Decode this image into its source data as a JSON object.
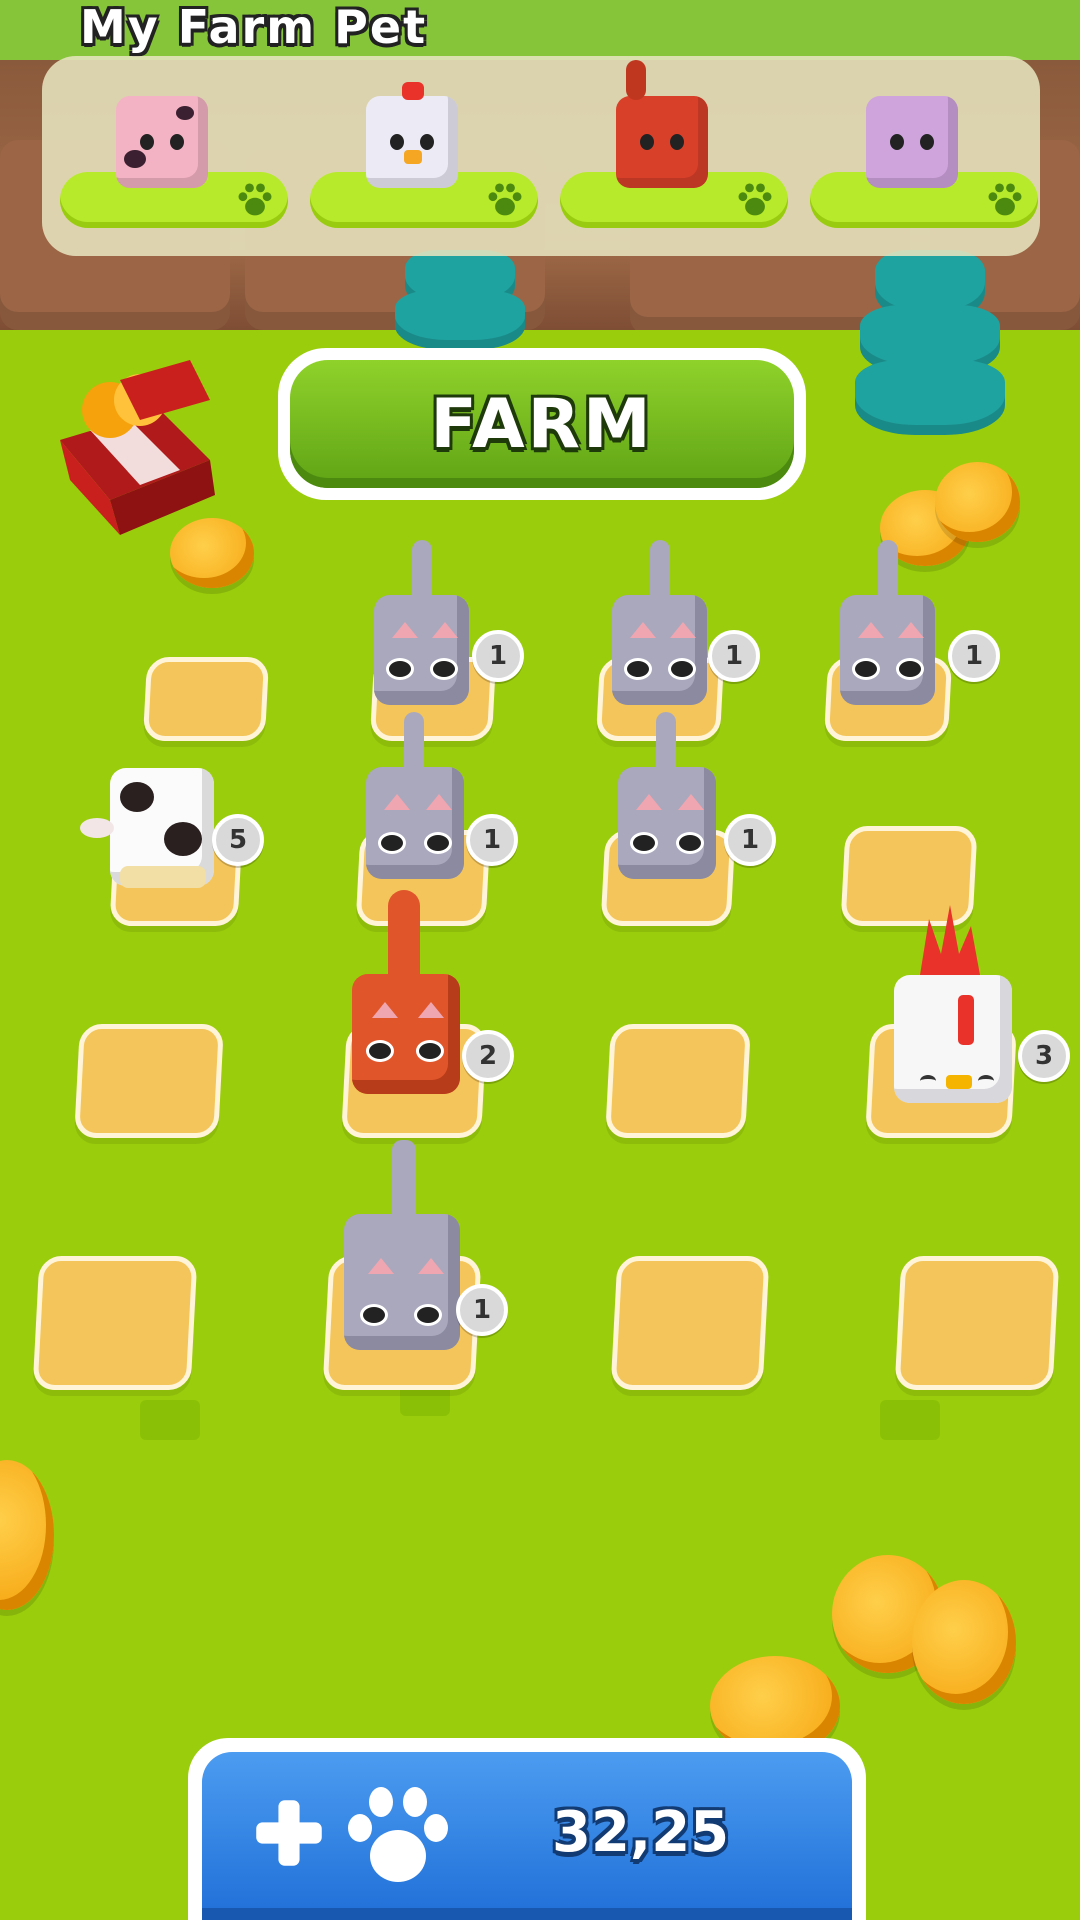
{
  "header": {
    "title": "My Farm Pet"
  },
  "pet_collection": [
    {
      "name": "cow-pig",
      "color": "#f4b3c4"
    },
    {
      "name": "chicken",
      "color": "#eceaf5"
    },
    {
      "name": "red-cat",
      "color": "#d8402a"
    },
    {
      "name": "purple-cat",
      "color": "#cfa4dd"
    }
  ],
  "farm_button": {
    "label": "FARM"
  },
  "grid_pets": [
    {
      "row": 1,
      "col": 2,
      "type": "gray-cat",
      "level": "1"
    },
    {
      "row": 1,
      "col": 3,
      "type": "gray-cat",
      "level": "1"
    },
    {
      "row": 1,
      "col": 4,
      "type": "gray-cat",
      "level": "1"
    },
    {
      "row": 2,
      "col": 1,
      "type": "cow",
      "level": "5"
    },
    {
      "row": 2,
      "col": 2,
      "type": "gray-cat",
      "level": "1"
    },
    {
      "row": 2,
      "col": 3,
      "type": "gray-cat",
      "level": "1"
    },
    {
      "row": 3,
      "col": 2,
      "type": "red-cat",
      "level": "2"
    },
    {
      "row": 3,
      "col": 4,
      "type": "chicken",
      "level": "3"
    },
    {
      "row": 4,
      "col": 2,
      "type": "gray-cat",
      "level": "1"
    }
  ],
  "buy_button": {
    "amount": "32,25",
    "icon": "plus-paw-icon"
  },
  "colors": {
    "grass": "#9acd0c",
    "tile": "#f4c55a",
    "farm_button": "#6bb31c",
    "buy_button": "#2b7fe0",
    "coin": "#f5a20c"
  }
}
